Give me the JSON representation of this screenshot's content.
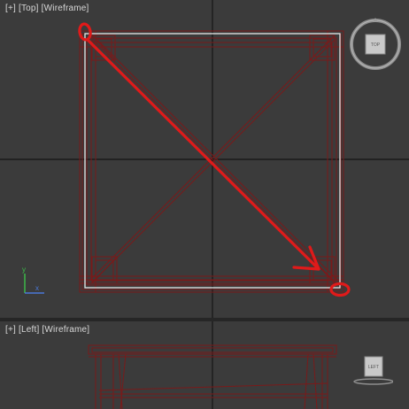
{
  "top_viewport": {
    "label_plus": "[+]",
    "label_view": "[Top]",
    "label_shading": "[Wireframe]",
    "viewcube_face": "TOP",
    "axis_y": "y",
    "axis_x": "x"
  },
  "left_viewport": {
    "label_plus": "[+]",
    "label_view": "[Left]",
    "label_shading": "[Wireframe]",
    "viewcube_face": "LEFT"
  },
  "colors": {
    "viewport_bg": "#3b3b3b",
    "grid_axis": "#141414",
    "wireframe": "#7a1a1a",
    "selection_box": "#e8e8e8",
    "annotation": "#e01a1a"
  }
}
